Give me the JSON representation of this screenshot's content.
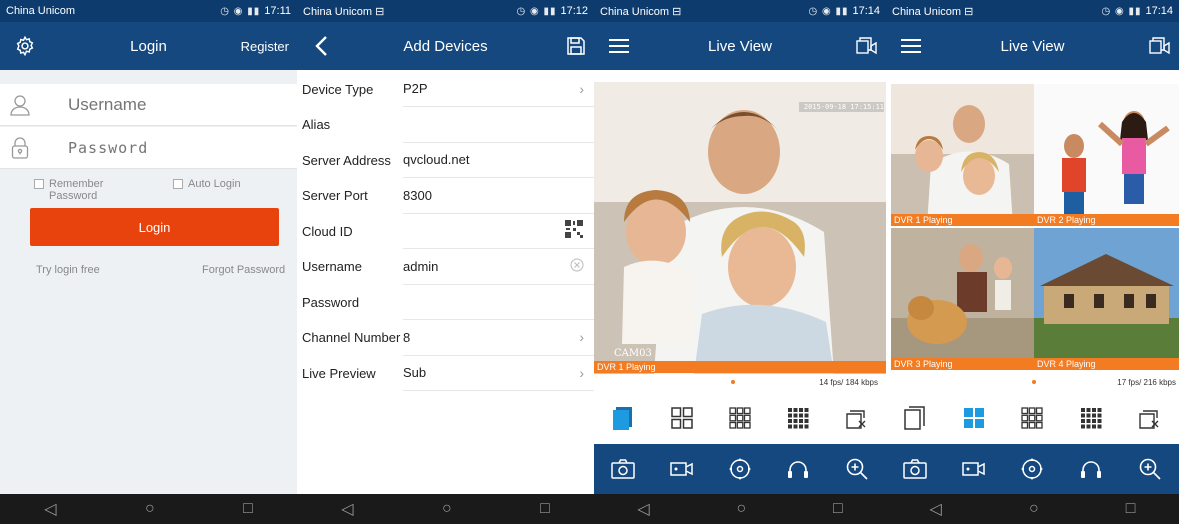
{
  "login_screen": {
    "status": {
      "carrier": "China Unicom",
      "time": "17:11"
    },
    "title": "Login",
    "register_label": "Register",
    "username_placeholder": "Username",
    "password_placeholder": "Password",
    "remember_label": "Remember\nPassword",
    "auto_login_label": "Auto Login",
    "login_button": "Login",
    "try_free_label": "Try login free",
    "forgot_label": "Forgot Password"
  },
  "add_devices_screen": {
    "status": {
      "carrier": "China Unicom ⊟",
      "time": "17:12"
    },
    "title": "Add Devices",
    "rows": [
      {
        "label": "Device Type",
        "value": "P2P"
      },
      {
        "label": "Alias",
        "value": ""
      },
      {
        "label": "Server Address",
        "value": "qvcloud.net"
      },
      {
        "label": "Server Port",
        "value": "8300"
      },
      {
        "label": "Cloud ID",
        "value": ""
      },
      {
        "label": "Username",
        "value": "admin"
      },
      {
        "label": "Password",
        "value": ""
      },
      {
        "label": "Channel Number",
        "value": "8"
      },
      {
        "label": "Live Preview",
        "value": "Sub"
      }
    ]
  },
  "live_view_single": {
    "status": {
      "carrier": "China Unicom ⊟",
      "time": "17:14"
    },
    "title": "Live View",
    "timestamp": "2015-09-18 17:15:11",
    "cam_label": "CAM03",
    "caption": "DVR 1  Playing",
    "fps": "14 fps/ 184 kbps"
  },
  "live_view_quad": {
    "status": {
      "carrier": "China Unicom ⊟",
      "time": "17:14"
    },
    "title": "Live View",
    "captions": [
      "DVR 1  Playing",
      "DVR 2  Playing",
      "DVR 3  Playing",
      "DVR 4  Playing"
    ],
    "fps": "17 fps/ 216 kbps"
  },
  "colors": {
    "accent_orange": "#e8430c",
    "header_blue": "#14487f",
    "status_blue": "#0e3b6e",
    "active_icon": "#1e9be0"
  }
}
